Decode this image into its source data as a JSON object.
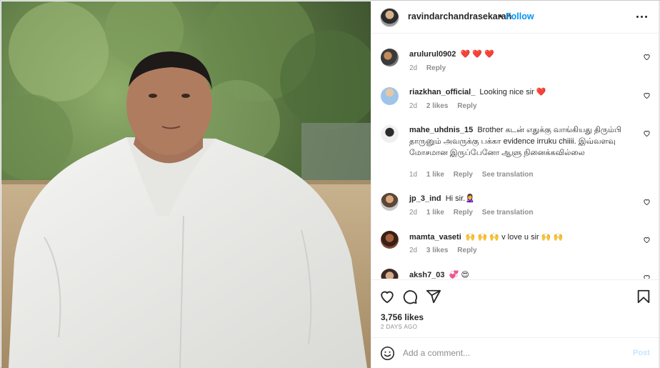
{
  "post": {
    "username": "ravindarchandrasekaran",
    "separator": "•",
    "follow_label": "Follow",
    "more_icon": "more-horizontal-icon"
  },
  "comments": [
    {
      "username": "arulurul0902",
      "text": "❤️ ❤️ ❤️",
      "time": "2d",
      "likes": "",
      "reply": "Reply",
      "translation": ""
    },
    {
      "username": "riazkhan_official_",
      "text": "Looking nice sir ❤️",
      "time": "2d",
      "likes": "2 likes",
      "reply": "Reply",
      "translation": ""
    },
    {
      "username": "mahe_uhdnis_15",
      "text": "Brother கடன் எதுக்கு வாங்கியது திரும்பி தாருனும் அவருக்கு பக்கா evidence irruku chiiii. இவ்வளவு மோசமான இருப்பேனோ ஆளு நினைக்கவில்லை",
      "time": "1d",
      "likes": "1 like",
      "reply": "Reply",
      "translation": "See translation"
    },
    {
      "username": "jp_3_ind",
      "text": "Hi sir.🙎‍♀️",
      "time": "2d",
      "likes": "1 like",
      "reply": "Reply",
      "translation": "See translation"
    },
    {
      "username": "mamta_vaseti",
      "text": "🙌 🙌 🙌  v love u sir 🙌 🙌",
      "time": "2d",
      "likes": "3 likes",
      "reply": "Reply",
      "translation": ""
    },
    {
      "username": "aksh7_03",
      "text": "💞 😍",
      "time": "",
      "likes": "",
      "reply": "",
      "translation": ""
    }
  ],
  "engagement": {
    "likes": "3,756 likes",
    "posted": "2 DAYS AGO"
  },
  "composer": {
    "placeholder": "Add a comment...",
    "post_label": "Post"
  },
  "colors": {
    "accent": "#0095f6",
    "heart_red": "#ed4956",
    "muted": "#8e8e8e"
  }
}
